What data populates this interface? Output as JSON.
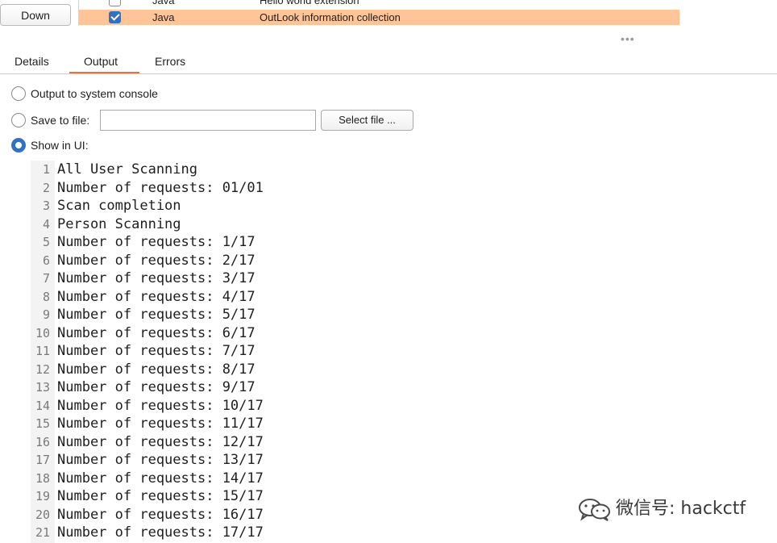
{
  "extensions": {
    "down_button": "Down",
    "rows": [
      {
        "loaded": false,
        "type": "Java",
        "name": "Hello world extension"
      },
      {
        "loaded": true,
        "type": "Java",
        "name": "OutLook information collection"
      }
    ]
  },
  "tabs": [
    {
      "label": "Details",
      "active": false
    },
    {
      "label": "Output",
      "active": true
    },
    {
      "label": "Errors",
      "active": false
    }
  ],
  "output_options": {
    "system_console_label": "Output to system console",
    "save_to_file_label": "Save to file:",
    "file_path_value": "",
    "select_file_button": "Select file ...",
    "show_in_ui_label": "Show in UI:",
    "selected": "show_in_ui"
  },
  "console_lines": [
    {
      "n": "1",
      "text": "All User Scanning"
    },
    {
      "n": "2",
      "text": "Number of requests: 01/01"
    },
    {
      "n": "3",
      "text": "Scan completion"
    },
    {
      "n": "4",
      "text": "Person Scanning"
    },
    {
      "n": "5",
      "text": "Number of requests: 1/17"
    },
    {
      "n": "6",
      "text": "Number of requests: 2/17"
    },
    {
      "n": "7",
      "text": "Number of requests: 3/17"
    },
    {
      "n": "8",
      "text": "Number of requests: 4/17"
    },
    {
      "n": "9",
      "text": "Number of requests: 5/17"
    },
    {
      "n": "10",
      "text": "Number of requests: 6/17"
    },
    {
      "n": "11",
      "text": "Number of requests: 7/17"
    },
    {
      "n": "12",
      "text": "Number of requests: 8/17"
    },
    {
      "n": "13",
      "text": "Number of requests: 9/17"
    },
    {
      "n": "14",
      "text": "Number of requests: 10/17"
    },
    {
      "n": "15",
      "text": "Number of requests: 11/17"
    },
    {
      "n": "16",
      "text": "Number of requests: 12/17"
    },
    {
      "n": "17",
      "text": "Number of requests: 13/17"
    },
    {
      "n": "18",
      "text": "Number of requests: 14/17"
    },
    {
      "n": "19",
      "text": "Number of requests: 15/17"
    },
    {
      "n": "20",
      "text": "Number of requests: 16/17"
    },
    {
      "n": "21",
      "text": "Number of requests: 17/17"
    }
  ],
  "watermark": {
    "text": "微信号: hackctf",
    "icon": "wechat-icon"
  },
  "colors": {
    "selected_row": "#ffc599",
    "active_tab_underline": "#e8713c",
    "accent_blue": "#2f72c4"
  }
}
